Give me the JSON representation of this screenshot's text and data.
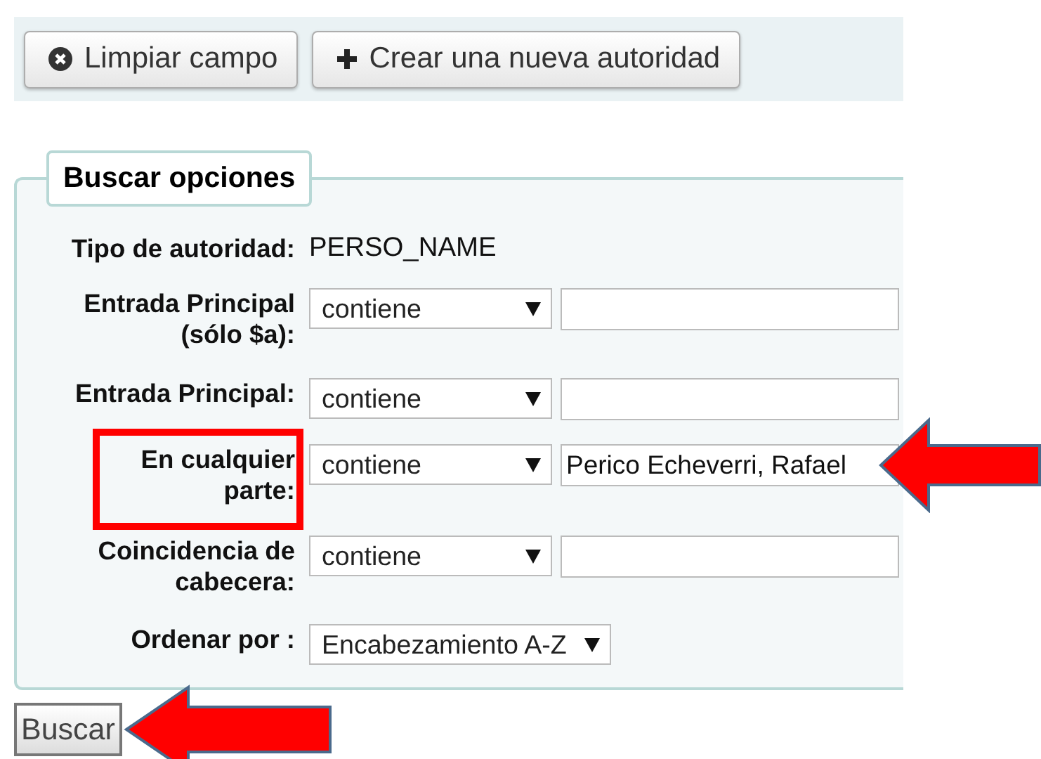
{
  "toolbar": {
    "buttons": [
      {
        "label": "Limpiar campo"
      },
      {
        "label": "Crear una nueva autoridad"
      }
    ]
  },
  "search_options": {
    "legend": "Buscar opciones",
    "authority_type": {
      "label": "Tipo de autoridad:",
      "value": "PERSO_NAME"
    },
    "rows": [
      {
        "label": "Entrada Principal (sólo $a):",
        "operator": "contiene",
        "value": "",
        "highlighted": false
      },
      {
        "label": "Entrada Principal:",
        "operator": "contiene",
        "value": "",
        "highlighted": false
      },
      {
        "label": "En cualquier parte:",
        "operator": "contiene",
        "value": "Perico Echeverri, Rafael",
        "highlighted": true,
        "arrow": true
      },
      {
        "label": "Coincidencia de cabecera:",
        "operator": "contiene",
        "value": "",
        "highlighted": false
      }
    ],
    "sort": {
      "label": "Ordenar por :",
      "value": "Encabezamiento A-Z"
    }
  },
  "submit": {
    "label": "Buscar",
    "arrow": true
  }
}
